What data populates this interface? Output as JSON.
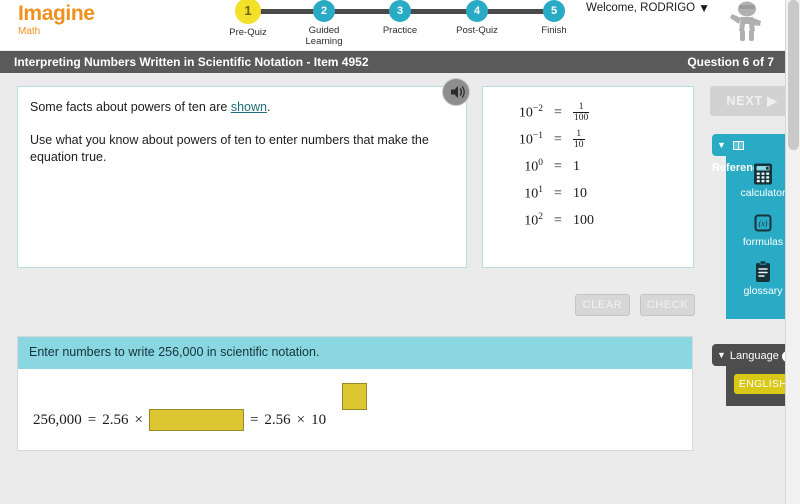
{
  "brand": {
    "name": "Imagine",
    "subtitle": "Math",
    "color": "#f0901e"
  },
  "stepper": {
    "steps": [
      {
        "number": "1",
        "label": "Pre-Quiz",
        "state": "current"
      },
      {
        "number": "2",
        "label": "Guided Learning",
        "state": "upcoming"
      },
      {
        "number": "3",
        "label": "Practice",
        "state": "upcoming"
      },
      {
        "number": "4",
        "label": "Post-Quiz",
        "state": "upcoming"
      },
      {
        "number": "5",
        "label": "Finish",
        "state": "upcoming"
      }
    ],
    "current_color": "#f2e029",
    "other_color": "#29abc6"
  },
  "account": {
    "welcome": "Welcome, RODRIGO",
    "caret": "▼",
    "avatar_icon": "user-avatar-icon"
  },
  "titlebar": {
    "title": "Interpreting Numbers Written in Scientific Notation - Item 4952",
    "question_counter": "Question 6 of 7",
    "background": "#5a5a5a"
  },
  "question": {
    "line1_before": "Some facts about powers of ten are ",
    "line1_link": "shown",
    "line1_after": ".",
    "line2": "Use what you know about powers of ten to enter numbers that make the equation true.",
    "speaker_icon": "speaker-audio-icon"
  },
  "facts": {
    "rows": [
      {
        "base": "10",
        "exponent": "−2",
        "equals": "=",
        "value_num": "1",
        "value_den": "100",
        "is_fraction": true
      },
      {
        "base": "10",
        "exponent": "−1",
        "equals": "=",
        "value_num": "1",
        "value_den": "10",
        "is_fraction": true
      },
      {
        "base": "10",
        "exponent": "0",
        "equals": "=",
        "value": "1",
        "is_fraction": false
      },
      {
        "base": "10",
        "exponent": "1",
        "equals": "=",
        "value": "10",
        "is_fraction": false
      },
      {
        "base": "10",
        "exponent": "2",
        "equals": "=",
        "value": "100",
        "is_fraction": false
      }
    ]
  },
  "actions": {
    "clear_label": "CLEAR",
    "check_label": "CHECK",
    "next_label": "NEXT",
    "next_arrow": "▶"
  },
  "answer": {
    "prompt": "Enter numbers to write 256,000 in scientific notation.",
    "header_color": "#8ad7e2",
    "equation": {
      "lhs": "256,000",
      "eq1": "=",
      "coefficient": "2.56",
      "times1": "×",
      "mantissa_input_value": "",
      "eq2": "=",
      "coefficient2": "2.56",
      "times2": "×",
      "base": "10",
      "exponent_input_value": ""
    },
    "input_color": "#dcc631"
  },
  "reference_panel": {
    "tab_label": "Reference",
    "tab_icon": "book-icon",
    "collapse_arrow": "▼",
    "background": "#29abc6",
    "items": [
      {
        "label": "calculator",
        "icon": "calculator-icon"
      },
      {
        "label": "formulas",
        "icon": "formulas-icon"
      },
      {
        "label": "glossary",
        "icon": "glossary-clipboard-icon"
      }
    ]
  },
  "language_panel": {
    "tab_label": "Language",
    "info_icon": "info-icon",
    "collapse_arrow": "▼",
    "selected_language": "ENGLISH",
    "background": "#4d4d4d",
    "button_color": "#d9c816"
  },
  "scrollbar": {
    "name": "page-scrollbar"
  }
}
